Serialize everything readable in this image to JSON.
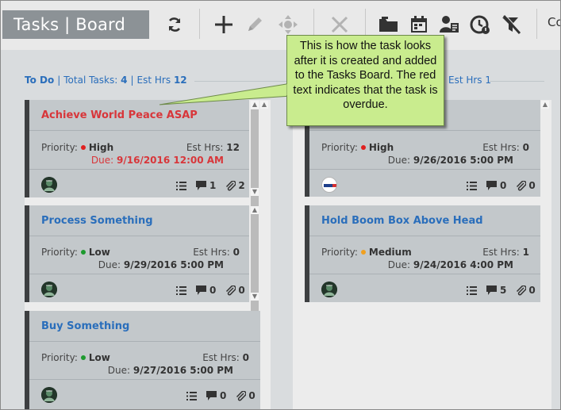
{
  "app": {
    "title": "Tasks | Board"
  },
  "toolbar": {
    "icons": [
      "refresh-icon",
      "add-icon",
      "edit-icon",
      "move-icon",
      "delete-icon",
      "folder-icon",
      "calendar-icon",
      "assign-user-icon",
      "clock-icon",
      "filter-off-icon"
    ],
    "clipped_label": "Co"
  },
  "columns": [
    {
      "name": "To Do",
      "total_label": "Total Tasks:",
      "total": "4",
      "est_label": "Est Hrs",
      "est": "12",
      "cards": [
        {
          "title": "Achieve World Peace ASAP",
          "title_color": "#d8363a",
          "priority_label": "Priority:",
          "priority": "High",
          "priority_color": "#e02020",
          "est_label": "Est Hrs:",
          "est": "12",
          "due_label": "Due:",
          "due": "9/16/2016 12:00 AM",
          "overdue": true,
          "comments": "1",
          "attachments": "2"
        },
        {
          "title": "Process Something",
          "title_color": "#2a6ebb",
          "priority_label": "Priority:",
          "priority": "Low",
          "priority_color": "#1d9a2e",
          "est_label": "Est Hrs:",
          "est": "0",
          "due_label": "Due:",
          "due": "9/29/2016 5:00 PM",
          "overdue": false,
          "comments": "0",
          "attachments": "0"
        },
        {
          "title": "Buy Something",
          "title_color": "#2a6ebb",
          "priority_label": "Priority:",
          "priority": "Low",
          "priority_color": "#1d9a2e",
          "est_label": "Est Hrs:",
          "est": "0",
          "due_label": "Due:",
          "due": "9/27/2016 5:00 PM",
          "overdue": false,
          "comments": "0",
          "attachments": "0"
        }
      ]
    },
    {
      "header_partial": "Est Hrs 1",
      "cards": [
        {
          "priority_label": "Priority:",
          "priority": "High",
          "priority_color": "#e02020",
          "est_label": "Est Hrs:",
          "est": "0",
          "due_label": "Due:",
          "due": "9/26/2016 5:00 PM",
          "comments": "0",
          "attachments": "0"
        },
        {
          "title": "Hold Boom Box Above Head",
          "title_color": "#2a6ebb",
          "priority_label": "Priority:",
          "priority": "Medium",
          "priority_color": "#f0a020",
          "est_label": "Est Hrs:",
          "est": "1",
          "due_label": "Due:",
          "due": "9/24/2016 4:00 PM",
          "comments": "5",
          "attachments": "0"
        }
      ]
    }
  ],
  "callout": {
    "text": "This is how the task looks after it is created and added to the Tasks Board. The red text indicates that the task is overdue."
  }
}
